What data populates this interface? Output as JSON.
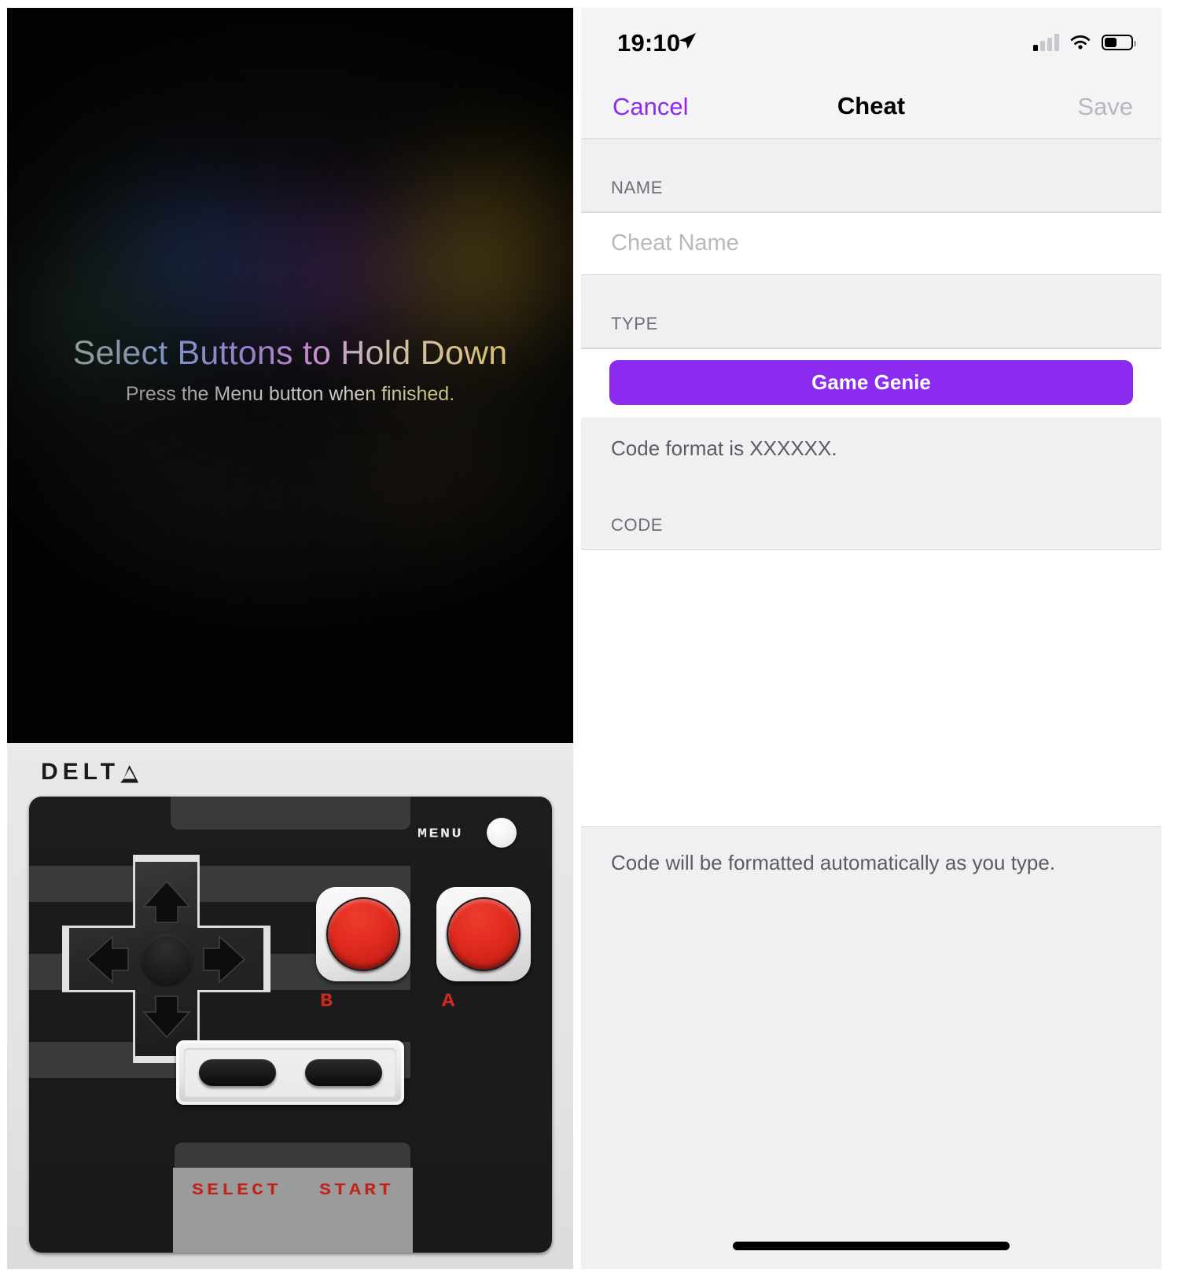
{
  "left": {
    "game_overlay": {
      "headline": "Select Buttons to Hold Down",
      "subline": "Press the Menu button when finished."
    },
    "controller": {
      "brand": "DELTA",
      "menu_label": "MENU",
      "menu_button_name": "menu-button",
      "buttons": {
        "b_label": "B",
        "a_label": "A",
        "select_label": "SELECT",
        "start_label": "START"
      },
      "dpad": {
        "up": "up-arrow",
        "down": "down-arrow",
        "left": "left-arrow",
        "right": "right-arrow"
      }
    }
  },
  "right": {
    "status_bar": {
      "time": "19:10",
      "location_icon": "location-arrow-icon",
      "cellular_icon": "cellular-signal-icon",
      "wifi_icon": "wifi-icon",
      "battery_icon": "battery-icon"
    },
    "navbar": {
      "cancel": "Cancel",
      "title": "Cheat",
      "save": "Save"
    },
    "sections": {
      "name_header": "NAME",
      "name_placeholder": "Cheat Name",
      "name_value": "",
      "type_header": "TYPE",
      "type_options": [
        "Game Genie"
      ],
      "type_selected": "Game Genie",
      "type_note": "Code format is XXXXXX.",
      "code_header": "CODE",
      "code_value": "",
      "code_footer": "Code will be formatted automatically as you type."
    }
  },
  "colors": {
    "accent_purple": "#8b2bf0",
    "save_disabled": "#b9b9bd",
    "group_bg": "#f0f0f3",
    "nav_bg": "#f4f4f6",
    "controller_red": "#cf2a22"
  }
}
